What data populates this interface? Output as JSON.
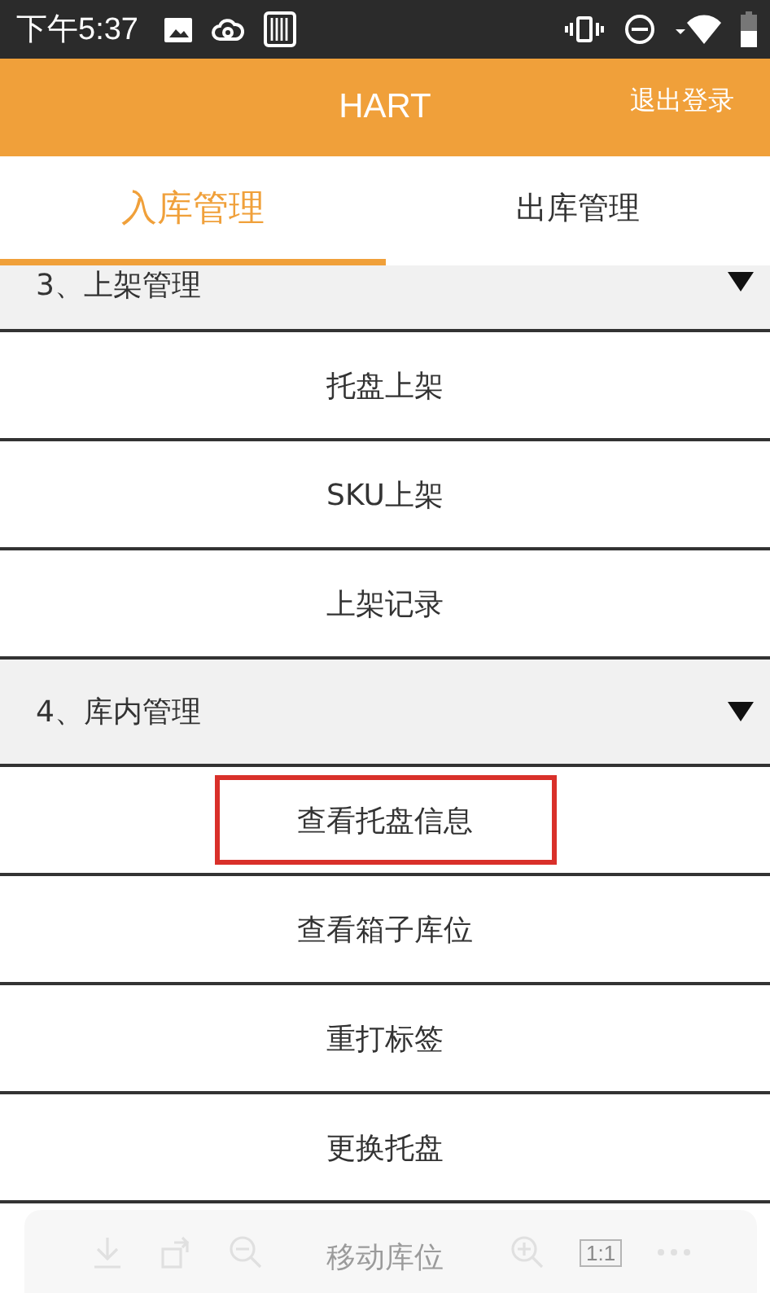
{
  "status_bar": {
    "time": "下午5:37"
  },
  "header": {
    "title": "HART",
    "action": "退出登录"
  },
  "tabs": [
    {
      "label": "入库管理",
      "selected": true
    },
    {
      "label": "出库管理",
      "selected": false
    }
  ],
  "sections": [
    {
      "title": "3、上架管理",
      "expanded": true,
      "items": [
        {
          "label": "托盘上架",
          "highlighted": false
        },
        {
          "label": "SKU上架",
          "highlighted": false
        },
        {
          "label": "上架记录",
          "highlighted": false
        }
      ]
    },
    {
      "title": "4、库内管理",
      "expanded": true,
      "items": [
        {
          "label": "查看托盘信息",
          "highlighted": true
        },
        {
          "label": "查看箱子库位",
          "highlighted": false
        },
        {
          "label": "重打标签",
          "highlighted": false
        },
        {
          "label": "更换托盘",
          "highlighted": false
        },
        {
          "label": "移动库位",
          "highlighted": false
        }
      ]
    }
  ],
  "viewer_toolbar": {
    "items": [
      {
        "kind": "download"
      },
      {
        "kind": "rotate"
      },
      {
        "kind": "zoom_out"
      },
      {
        "kind": "gap"
      },
      {
        "kind": "zoom_in"
      },
      {
        "kind": "actual_size",
        "label": "1:1"
      },
      {
        "kind": "more"
      }
    ]
  }
}
